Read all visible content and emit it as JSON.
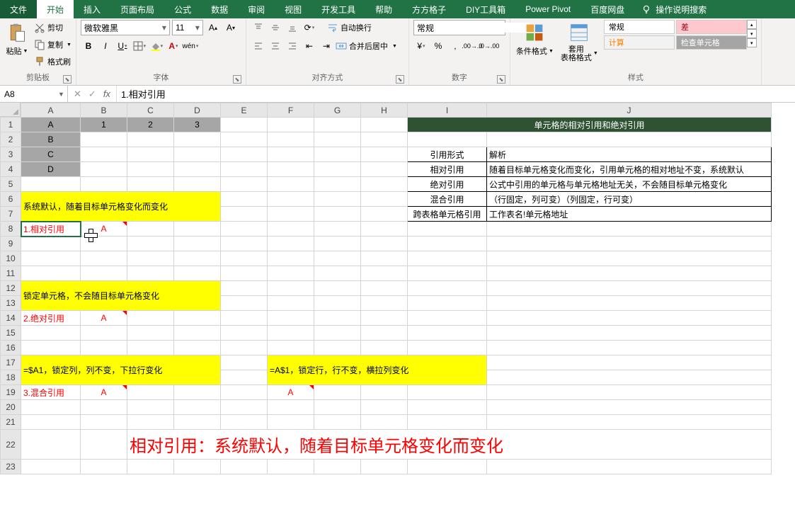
{
  "tabs": [
    "文件",
    "开始",
    "插入",
    "页面布局",
    "公式",
    "数据",
    "审阅",
    "视图",
    "开发工具",
    "帮助",
    "方方格子",
    "DIY工具箱",
    "Power Pivot",
    "百度网盘"
  ],
  "active_tab_index": 1,
  "tell_me": "操作说明搜索",
  "ribbon": {
    "clipboard": {
      "paste": "粘贴",
      "cut": "剪切",
      "copy": "复制",
      "format": "格式刷",
      "label": "剪贴板"
    },
    "font": {
      "name": "微软雅黑",
      "size": "11",
      "label": "字体"
    },
    "align": {
      "wrap": "自动换行",
      "merge": "合并后居中",
      "label": "对齐方式"
    },
    "number": {
      "format": "常规",
      "label": "数字"
    },
    "styles": {
      "cond": "条件格式",
      "table": "套用\n表格格式",
      "normal": "常规",
      "bad": "差",
      "calc": "计算",
      "check": "检查单元格",
      "label": "样式"
    }
  },
  "name_box": "A8",
  "formula": "1.相对引用",
  "sheet": {
    "col_headers": [
      "A",
      "B",
      "C",
      "D",
      "E",
      "F",
      "G",
      "H",
      "I",
      "J"
    ],
    "row_headers": [
      "1",
      "2",
      "3",
      "4",
      "5",
      "6",
      "7",
      "8",
      "9",
      "10",
      "11",
      "12",
      "13",
      "14",
      "15",
      "16",
      "17",
      "18",
      "19",
      "20",
      "21",
      "22",
      "23"
    ],
    "cells": {
      "A1": "A",
      "B1": "1",
      "C1": "2",
      "D1": "3",
      "A2": "B",
      "A3": "C",
      "A4": "D",
      "I1J1": "单元格的相对引用和绝对引用",
      "A6": "系统默认，随着目标单元格变化而变化",
      "A8": "1.相对引用",
      "B8": "A",
      "A12": "锁定单元格，不会随目标单元格变化",
      "A14": "2.绝对引用",
      "B14": "A",
      "A17": "=$A1，锁定列，列不变，下拉行变化",
      "F17": "=A$1，锁定行，行不变，横拉列变化",
      "A19": "3.混合引用",
      "B19": "A",
      "F19": "A",
      "I3": "引用形式",
      "J3": "解析",
      "I4": "相对引用",
      "J4": "随着目标单元格变化而变化，引用单元格的相对地址不变，系统默认",
      "I5": "绝对引用",
      "J5": "公式中引用的单元格与单元格地址无关，不会随目标单元格变化",
      "I6": "混合引用",
      "J6": "（行固定，列可变）（列固定，行可变）",
      "I7": "跨表格单元格引用",
      "J7": "工作表名!单元格地址",
      "big": "相对引用：系统默认，随着目标单元格变化而变化"
    }
  },
  "chart_data": {
    "type": "table",
    "title": "单元格的相对引用和绝对引用",
    "headers": [
      "引用形式",
      "解析"
    ],
    "rows": [
      [
        "相对引用",
        "随着目标单元格变化而变化，引用单元格的相对地址不变，系统默认"
      ],
      [
        "绝对引用",
        "公式中引用的单元格与单元格地址无关，不会随目标单元格变化"
      ],
      [
        "混合引用",
        "（行固定，列可变）（列固定，行可变）"
      ],
      [
        "跨表格单元格引用",
        "工作表名!单元格地址"
      ]
    ]
  }
}
